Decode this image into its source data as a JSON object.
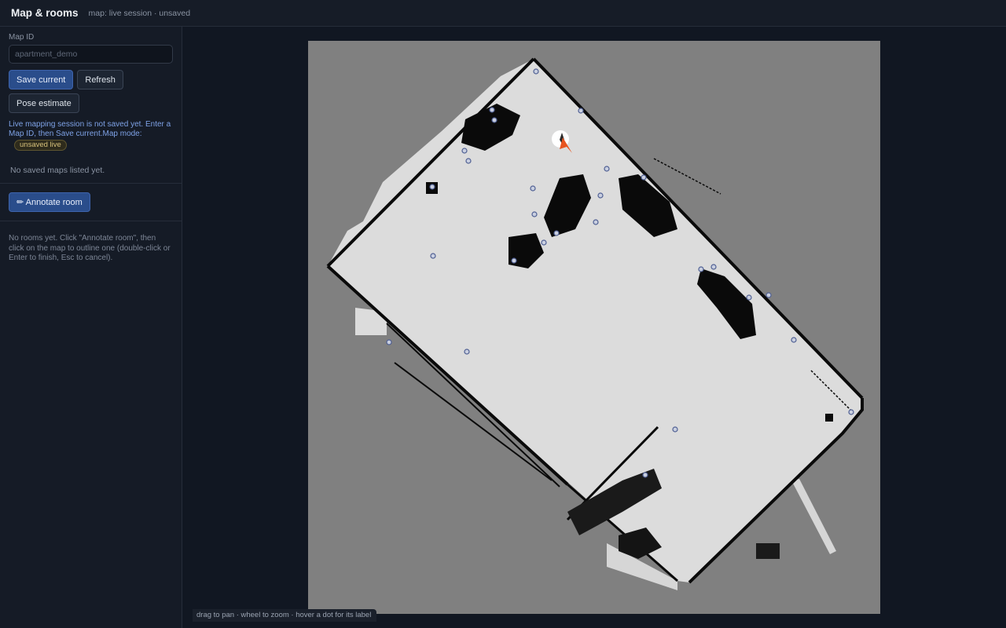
{
  "header": {
    "title": "Map & rooms",
    "subtitle": "map: live session · unsaved"
  },
  "sidebar": {
    "map_id_label": "Map ID",
    "map_id_placeholder": "apartment_demo",
    "map_id_value": "",
    "buttons": {
      "save": "Save current",
      "refresh": "Refresh",
      "pose": "Pose estimate",
      "annotate": "✏ Annotate room"
    },
    "note": "Live mapping session is not saved yet. Enter a Map ID, then Save current.Map mode:",
    "mode_badge": "unsaved live",
    "empty_maps": "No saved maps listed yet.",
    "rooms_empty": "No rooms yet. Click \"Annotate room\", then click on the map to outline one (double-click or Enter to finish, Esc to cancel)."
  },
  "map": {
    "hint": "drag to pan · wheel to zoom · hover a dot for its label",
    "colors": {
      "unknown": "#808080",
      "free": "#dcdcdc",
      "wall": "#0a0a0a",
      "waypoint": "#5b73b4",
      "robot": "#e8541f"
    }
  }
}
